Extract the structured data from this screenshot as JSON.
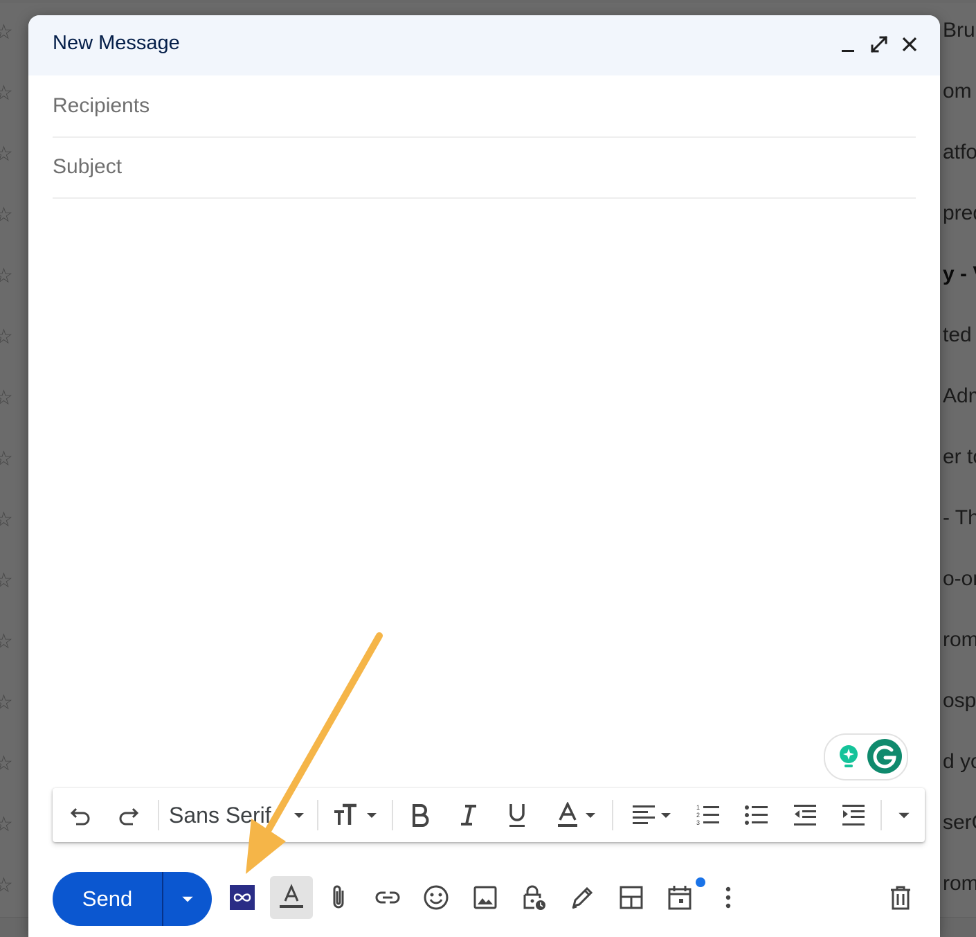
{
  "background": {
    "rows": [
      {
        "text": "Bru",
        "bold": false
      },
      {
        "text": "om T",
        "bold": false
      },
      {
        "text": "atfo",
        "bold": false
      },
      {
        "text": "pred",
        "bold": false
      },
      {
        "text": "y - V",
        "bold": true
      },
      {
        "text": "ted",
        "bold": false
      },
      {
        "text": "Adm",
        "bold": false
      },
      {
        "text": "er to",
        "bold": false
      },
      {
        "text": "- Th",
        "bold": false
      },
      {
        "text": "o-or",
        "bold": false
      },
      {
        "text": "rom",
        "bold": false
      },
      {
        "text": "osp-",
        "bold": false
      },
      {
        "text": "d yo",
        "bold": false
      },
      {
        "text": "serC",
        "bold": false
      },
      {
        "text": "rom",
        "bold": false
      }
    ]
  },
  "compose": {
    "title": "New Message",
    "recipients_placeholder": "Recipients",
    "subject_placeholder": "Subject"
  },
  "toolbar": {
    "font_name": "Sans Serif"
  },
  "send": {
    "label": "Send"
  },
  "colors": {
    "send_blue": "#0b57d0",
    "header_bg": "#f2f6fc",
    "arrow": "#f5b548",
    "grammarly_green": "#15c39a"
  }
}
